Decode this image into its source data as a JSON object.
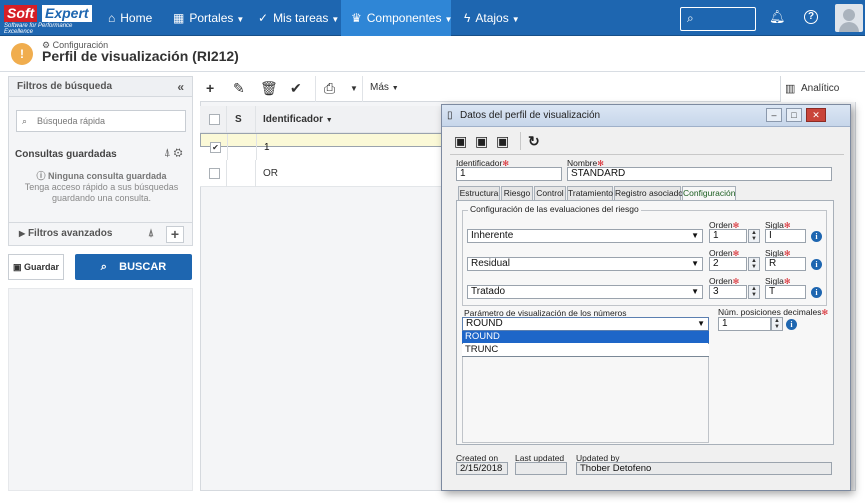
{
  "topbar": {
    "logo_soft": "Soft",
    "logo_expert": "Expert",
    "logo_tagline": "Software for Performance Excellence",
    "nav": [
      {
        "label": "Home"
      },
      {
        "label": "Portales"
      },
      {
        "label": "Mis tareas"
      },
      {
        "label": "Componentes"
      },
      {
        "label": "Atajos"
      }
    ]
  },
  "header": {
    "breadcrumb": "Configuración",
    "title": "Perfil de visualización (RI212)"
  },
  "left": {
    "filters_title": "Filtros de búsqueda",
    "quick_search_placeholder": "Búsqueda rápida",
    "saved_queries": "Consultas guardadas",
    "no_saved": "Ninguna consulta guardada",
    "no_saved_hint_1": "Tenga acceso rápido a sus búsquedas",
    "no_saved_hint_2": "guardando una consulta.",
    "advanced_filters": "Filtros avanzados",
    "save_label": "Guardar",
    "search_label": "BUSCAR"
  },
  "toolbar": {
    "more_label": "Más",
    "analytic_label": "Analítico"
  },
  "grid": {
    "col_s": "S",
    "col_id": "Identificador",
    "rows": [
      {
        "id": "1",
        "checked": true
      },
      {
        "id": "OR",
        "checked": false
      }
    ]
  },
  "dialog": {
    "title": "Datos del perfil de visualización",
    "identifier_label": "Identificador",
    "identifier_value": "1",
    "name_label": "Nombre",
    "name_value": "STANDARD",
    "tabs": [
      "Estructura",
      "Riesgo",
      "Control",
      "Tratamiento",
      "Registro asociado",
      "Configuración"
    ],
    "group_title": "Configuración de las evaluaciones del riesgo",
    "order_label": "Orden",
    "acronym_label": "Sigla",
    "rows": [
      {
        "type": "Inherente",
        "order": "1",
        "acronym": "I"
      },
      {
        "type": "Residual",
        "order": "2",
        "acronym": "R"
      },
      {
        "type": "Tratado",
        "order": "3",
        "acronym": "T"
      }
    ],
    "numbers_param_label": "Parámetro de visualización de los números",
    "numbers_param_value": "ROUND",
    "numbers_options": [
      "ROUND",
      "TRUNC"
    ],
    "decimals_label": "Núm. posiciones decimales",
    "decimals_value": "1",
    "created_on_label": "Created on",
    "created_on_value": "2/15/2018",
    "last_updated_label": "Last updated",
    "last_updated_value": "",
    "updated_by_label": "Updated by",
    "updated_by_value": "Thober Detofeno"
  }
}
